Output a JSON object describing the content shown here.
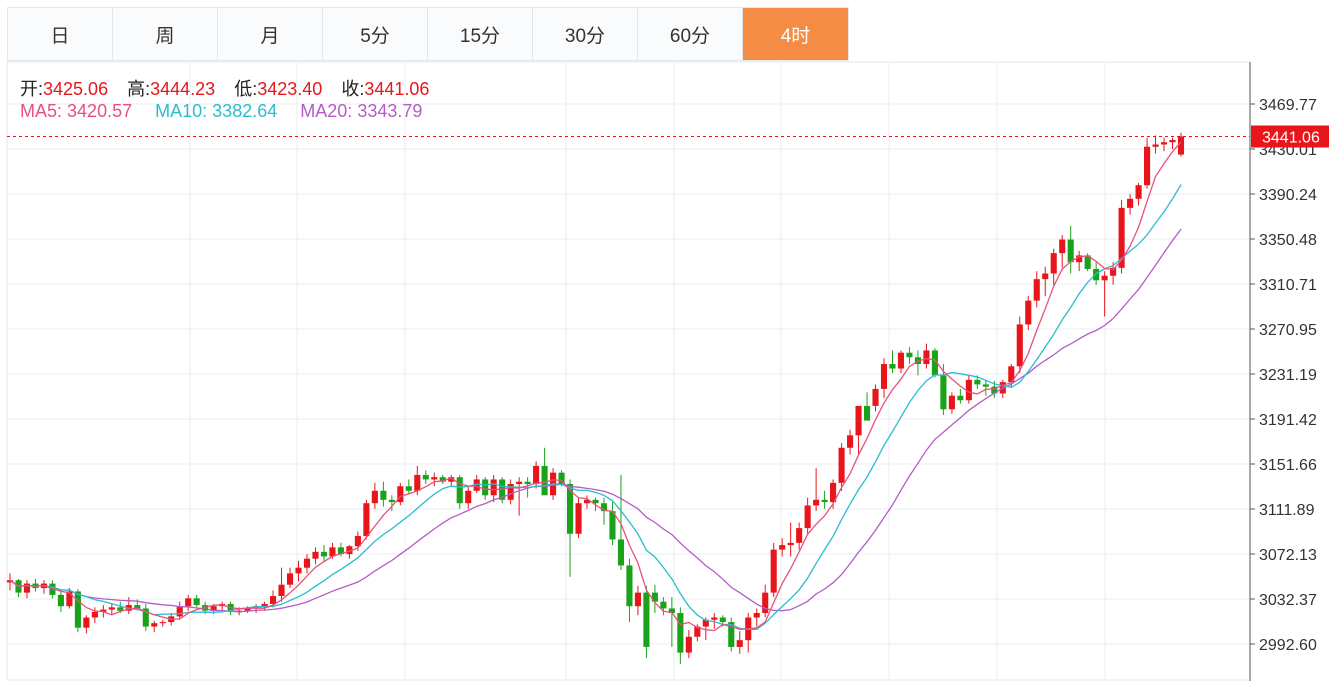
{
  "tabs": [
    {
      "label": "日",
      "active": false
    },
    {
      "label": "周",
      "active": false
    },
    {
      "label": "月",
      "active": false
    },
    {
      "label": "5分",
      "active": false
    },
    {
      "label": "15分",
      "active": false
    },
    {
      "label": "30分",
      "active": false
    },
    {
      "label": "60分",
      "active": false
    },
    {
      "label": "4时",
      "active": true
    }
  ],
  "info": {
    "open_label": "开:",
    "open": "3425.06",
    "high_label": "高:",
    "high": "3444.23",
    "low_label": "低:",
    "low": "3423.40",
    "close_label": "收:",
    "close": "3441.06",
    "ma5_label": "MA5:",
    "ma5": "3420.57",
    "ma10_label": "MA10:",
    "ma10": "3382.64",
    "ma20_label": "MA20:",
    "ma20": "3343.79"
  },
  "colors": {
    "up": "#e8161b",
    "down": "#1aa31a",
    "ma5": "#e8517c",
    "ma10": "#2cbcd0",
    "ma20": "#b45cc8",
    "accent": "#f48c45"
  },
  "chart_data": {
    "type": "candlestick",
    "y_ticks": [
      "3469.77",
      "3430.01",
      "3390.24",
      "3350.48",
      "3310.71",
      "3270.95",
      "3231.19",
      "3191.42",
      "3151.66",
      "3111.89",
      "3072.13",
      "3032.37",
      "2992.60"
    ],
    "ylim": [
      2970,
      3502
    ],
    "last_price": "3441.06",
    "grid": true,
    "candles": [
      [
        3047,
        3055,
        3040,
        3049
      ],
      [
        3049,
        3050,
        3034,
        3038
      ],
      [
        3038,
        3049,
        3033,
        3046
      ],
      [
        3046,
        3050,
        3039,
        3042
      ],
      [
        3042,
        3049,
        3037,
        3046
      ],
      [
        3046,
        3049,
        3033,
        3036
      ],
      [
        3036,
        3040,
        3021,
        3026
      ],
      [
        3026,
        3042,
        3024,
        3039
      ],
      [
        3039,
        3041,
        3003,
        3007
      ],
      [
        3007,
        3018,
        3002,
        3016
      ],
      [
        3016,
        3025,
        3011,
        3021
      ],
      [
        3021,
        3027,
        3016,
        3023
      ],
      [
        3023,
        3028,
        3019,
        3025
      ],
      [
        3025,
        3030,
        3020,
        3022
      ],
      [
        3022,
        3034,
        3019,
        3027
      ],
      [
        3027,
        3032,
        3023,
        3024
      ],
      [
        3024,
        3028,
        3004,
        3008
      ],
      [
        3008,
        3013,
        3003,
        3011
      ],
      [
        3011,
        3014,
        3008,
        3012
      ],
      [
        3012,
        3020,
        3009,
        3017
      ],
      [
        3017,
        3030,
        3014,
        3026
      ],
      [
        3026,
        3036,
        3022,
        3033
      ],
      [
        3033,
        3036,
        3025,
        3027
      ],
      [
        3027,
        3030,
        3019,
        3022
      ],
      [
        3022,
        3028,
        3019,
        3026
      ],
      [
        3026,
        3030,
        3022,
        3028
      ],
      [
        3028,
        3030,
        3018,
        3021
      ],
      [
        3021,
        3025,
        3018,
        3022
      ],
      [
        3022,
        3026,
        3020,
        3024
      ],
      [
        3024,
        3028,
        3020,
        3026
      ],
      [
        3026,
        3030,
        3022,
        3028
      ],
      [
        3028,
        3040,
        3025,
        3035
      ],
      [
        3035,
        3060,
        3030,
        3045
      ],
      [
        3045,
        3060,
        3042,
        3055
      ],
      [
        3055,
        3066,
        3048,
        3060
      ],
      [
        3060,
        3072,
        3055,
        3068
      ],
      [
        3068,
        3078,
        3063,
        3074
      ],
      [
        3074,
        3080,
        3066,
        3070
      ],
      [
        3070,
        3082,
        3068,
        3078
      ],
      [
        3078,
        3082,
        3070,
        3072
      ],
      [
        3072,
        3080,
        3068,
        3079
      ],
      [
        3079,
        3092,
        3075,
        3088
      ],
      [
        3088,
        3120,
        3085,
        3117
      ],
      [
        3117,
        3135,
        3112,
        3128
      ],
      [
        3128,
        3136,
        3114,
        3120
      ],
      [
        3120,
        3124,
        3110,
        3118
      ],
      [
        3118,
        3135,
        3115,
        3132
      ],
      [
        3132,
        3138,
        3125,
        3128
      ],
      [
        3128,
        3150,
        3124,
        3142
      ],
      [
        3142,
        3146,
        3134,
        3138
      ],
      [
        3138,
        3144,
        3132,
        3140
      ],
      [
        3140,
        3142,
        3134,
        3136
      ],
      [
        3136,
        3142,
        3132,
        3140
      ],
      [
        3140,
        3142,
        3112,
        3117
      ],
      [
        3117,
        3132,
        3112,
        3128
      ],
      [
        3128,
        3142,
        3126,
        3138
      ],
      [
        3138,
        3140,
        3120,
        3124
      ],
      [
        3124,
        3142,
        3118,
        3138
      ],
      [
        3138,
        3140,
        3117,
        3120
      ],
      [
        3120,
        3138,
        3116,
        3134
      ],
      [
        3134,
        3140,
        3106,
        3136
      ],
      [
        3136,
        3140,
        3122,
        3134
      ],
      [
        3134,
        3154,
        3130,
        3150
      ],
      [
        3150,
        3166,
        3138,
        3124
      ],
      [
        3124,
        3148,
        3120,
        3144
      ],
      [
        3144,
        3146,
        3132,
        3134
      ],
      [
        3134,
        3138,
        3052,
        3090
      ],
      [
        3090,
        3122,
        3086,
        3117
      ],
      [
        3117,
        3124,
        3112,
        3120
      ],
      [
        3120,
        3122,
        3110,
        3117
      ],
      [
        3117,
        3122,
        3098,
        3110
      ],
      [
        3110,
        3118,
        3080,
        3085
      ],
      [
        3085,
        3142,
        3058,
        3062
      ],
      [
        3062,
        3068,
        3012,
        3026
      ],
      [
        3026,
        3044,
        3018,
        3038
      ],
      [
        3038,
        3044,
        2980,
        2990
      ],
      [
        3038,
        3045,
        3020,
        3030
      ],
      [
        3030,
        3034,
        3018,
        3024
      ],
      [
        3024,
        3034,
        2990,
        3020
      ],
      [
        3020,
        3025,
        2975,
        2985
      ],
      [
        2985,
        3005,
        2980,
        2999
      ],
      [
        2999,
        3010,
        2995,
        3008
      ],
      [
        3008,
        3016,
        2996,
        3014
      ],
      [
        3014,
        3020,
        3006,
        3016
      ],
      [
        3016,
        3018,
        3008,
        3012
      ],
      [
        3012,
        3016,
        2986,
        2990
      ],
      [
        2990,
        3004,
        2984,
        2996
      ],
      [
        2996,
        3020,
        2985,
        3016
      ],
      [
        3016,
        3024,
        3008,
        3020
      ],
      [
        3020,
        3045,
        3016,
        3038
      ],
      [
        3038,
        3082,
        3034,
        3076
      ],
      [
        3076,
        3086,
        3070,
        3080
      ],
      [
        3080,
        3100,
        3070,
        3082
      ],
      [
        3082,
        3100,
        3076,
        3095
      ],
      [
        3095,
        3122,
        3090,
        3115
      ],
      [
        3115,
        3148,
        3110,
        3120
      ],
      [
        3120,
        3128,
        3112,
        3118
      ],
      [
        3118,
        3138,
        3112,
        3135
      ],
      [
        3135,
        3170,
        3128,
        3166
      ],
      [
        3166,
        3182,
        3160,
        3177
      ],
      [
        3177,
        3190,
        3160,
        3203
      ],
      [
        3203,
        3215,
        3195,
        3190
      ],
      [
        3203,
        3222,
        3198,
        3218
      ],
      [
        3218,
        3245,
        3210,
        3240
      ],
      [
        3240,
        3252,
        3232,
        3236
      ],
      [
        3236,
        3252,
        3232,
        3250
      ],
      [
        3250,
        3255,
        3240,
        3246
      ],
      [
        3246,
        3252,
        3230,
        3240
      ],
      [
        3240,
        3258,
        3236,
        3252
      ],
      [
        3252,
        3254,
        3228,
        3230
      ],
      [
        3230,
        3240,
        3195,
        3200
      ],
      [
        3200,
        3215,
        3196,
        3212
      ],
      [
        3212,
        3218,
        3205,
        3208
      ],
      [
        3208,
        3230,
        3205,
        3226
      ],
      [
        3226,
        3230,
        3218,
        3222
      ],
      [
        3222,
        3226,
        3212,
        3220
      ],
      [
        3220,
        3225,
        3210,
        3214
      ],
      [
        3214,
        3226,
        3210,
        3224
      ],
      [
        3224,
        3240,
        3220,
        3238
      ],
      [
        3238,
        3282,
        3232,
        3275
      ],
      [
        3275,
        3300,
        3270,
        3296
      ],
      [
        3296,
        3322,
        3290,
        3315
      ],
      [
        3315,
        3326,
        3300,
        3320
      ],
      [
        3320,
        3342,
        3310,
        3338
      ],
      [
        3338,
        3354,
        3325,
        3350
      ],
      [
        3350,
        3362,
        3320,
        3330
      ],
      [
        3330,
        3340,
        3322,
        3336
      ],
      [
        3336,
        3338,
        3322,
        3324
      ],
      [
        3324,
        3330,
        3310,
        3314
      ],
      [
        3314,
        3322,
        3282,
        3318
      ],
      [
        3318,
        3330,
        3310,
        3325
      ],
      [
        3325,
        3385,
        3320,
        3378
      ],
      [
        3378,
        3390,
        3372,
        3386
      ],
      [
        3386,
        3400,
        3380,
        3398
      ],
      [
        3398,
        3440,
        3395,
        3432
      ],
      [
        3432,
        3442,
        3426,
        3434
      ],
      [
        3434,
        3440,
        3428,
        3436
      ],
      [
        3436,
        3440,
        3430,
        3438
      ],
      [
        3425.06,
        3444.23,
        3423.4,
        3441.06
      ]
    ],
    "ma_window": {
      "ma5": 5,
      "ma10": 10,
      "ma20": 20
    }
  }
}
